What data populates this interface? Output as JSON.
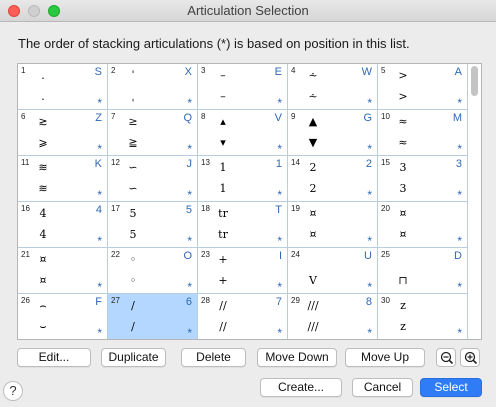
{
  "window": {
    "title": "Articulation Selection"
  },
  "instructions": "The order of stacking articulations (*) is based on position in this list.",
  "cells": [
    {
      "num": "1",
      "key": "S",
      "top": ".",
      "bot": "."
    },
    {
      "num": "2",
      "key": "X",
      "top": "ˈ",
      "bot": "ˌ"
    },
    {
      "num": "3",
      "key": "E",
      "top": "–",
      "bot": "–"
    },
    {
      "num": "4",
      "key": "W",
      "top": "⩪",
      "bot": "⩪"
    },
    {
      "num": "5",
      "key": "A",
      "top": ">",
      "bot": ">"
    },
    {
      "num": "6",
      "key": "Z",
      "top": "≳",
      "bot": "⩾"
    },
    {
      "num": "7",
      "key": "Q",
      "top": "≥",
      "bot": "≧"
    },
    {
      "num": "8",
      "key": "V",
      "top": "▴",
      "bot": "▾"
    },
    {
      "num": "9",
      "key": "G",
      "top": "▲",
      "bot": "▼"
    },
    {
      "num": "10",
      "key": "M",
      "top": "≈",
      "bot": "≈"
    },
    {
      "num": "11",
      "key": "K",
      "top": "≋",
      "bot": "≋"
    },
    {
      "num": "12",
      "key": "J",
      "top": "∽",
      "bot": "∽"
    },
    {
      "num": "13",
      "key": "1",
      "top": "1",
      "bot": "1"
    },
    {
      "num": "14",
      "key": "2",
      "top": "2",
      "bot": "2"
    },
    {
      "num": "15",
      "key": "3",
      "top": "3",
      "bot": "3"
    },
    {
      "num": "16",
      "key": "4",
      "top": "4",
      "bot": "4"
    },
    {
      "num": "17",
      "key": "5",
      "top": "5",
      "bot": "5"
    },
    {
      "num": "18",
      "key": "T",
      "top": "tr",
      "bot": "tr"
    },
    {
      "num": "19",
      "key": "",
      "top": "¤",
      "bot": "¤"
    },
    {
      "num": "20",
      "key": "",
      "top": "¤",
      "bot": "¤"
    },
    {
      "num": "21",
      "key": "",
      "top": "¤",
      "bot": "¤"
    },
    {
      "num": "22",
      "key": "O",
      "top": "◦",
      "bot": "◦"
    },
    {
      "num": "23",
      "key": "I",
      "top": "+",
      "bot": "+"
    },
    {
      "num": "24",
      "key": "U",
      "top": "",
      "bot": "V"
    },
    {
      "num": "25",
      "key": "D",
      "top": "",
      "bot": "⊓"
    },
    {
      "num": "26",
      "key": "F",
      "top": "⌢",
      "bot": "⌣"
    },
    {
      "num": "27",
      "key": "6",
      "top": "/",
      "bot": "/"
    },
    {
      "num": "28",
      "key": "7",
      "top": "//",
      "bot": "//"
    },
    {
      "num": "29",
      "key": "8",
      "top": "///",
      "bot": "///"
    },
    {
      "num": "30",
      "key": "",
      "top": "z",
      "bot": "z"
    }
  ],
  "star": "*",
  "buttons": {
    "edit": "Edit...",
    "duplicate": "Duplicate",
    "delete": "Delete",
    "move_down": "Move Down",
    "move_up": "Move Up",
    "create": "Create...",
    "cancel": "Cancel",
    "select": "Select",
    "help": "?"
  },
  "selected_index": 26,
  "colors": {
    "accent": "#2f7cf6",
    "selection": "#b3d7ff",
    "key_text": "#2f68b4"
  }
}
